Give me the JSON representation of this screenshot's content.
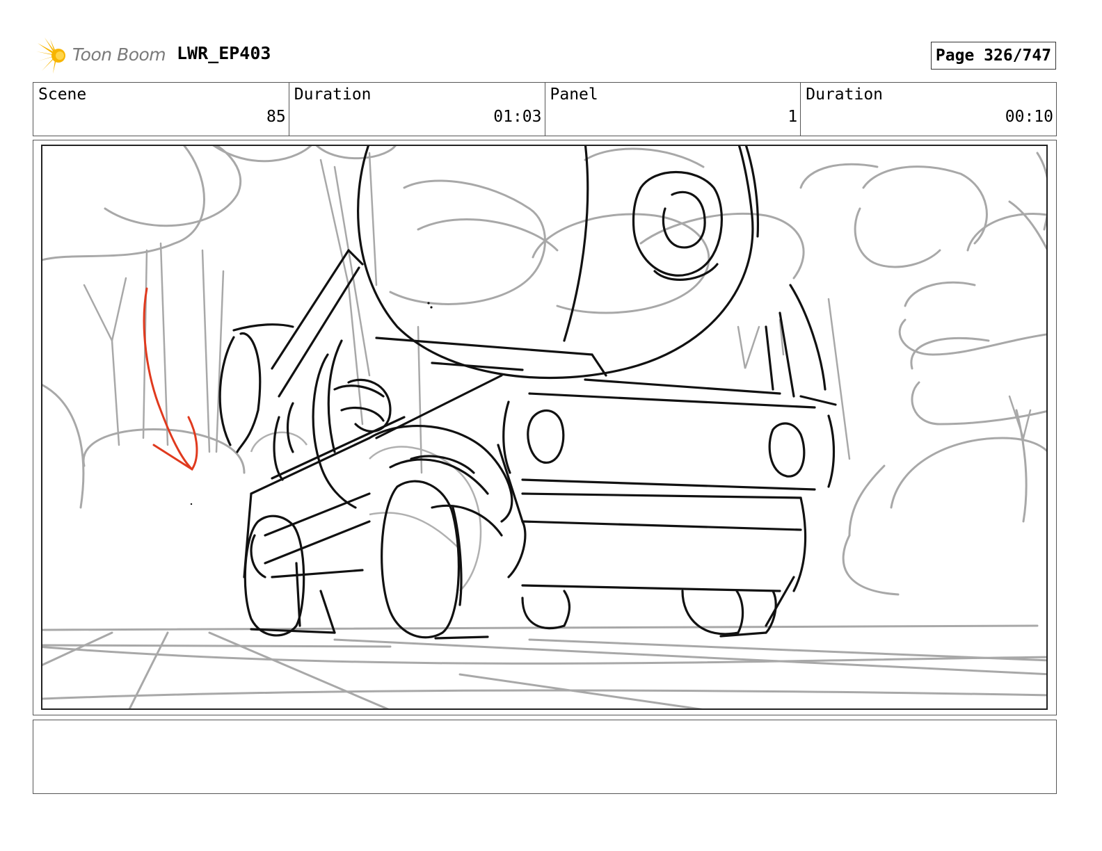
{
  "header": {
    "logo_text": "Toon Boom",
    "project_title": "LWR_EP403",
    "page_label": "Page 326/747"
  },
  "info": {
    "scene_label": "Scene",
    "scene_value": "85",
    "scene_duration_label": "Duration",
    "scene_duration_value": "01:03",
    "panel_label": "Panel",
    "panel_value": "1",
    "panel_duration_label": "Duration",
    "panel_duration_value": "00:10"
  },
  "colors": {
    "sketch_line": "#111111",
    "background_line": "#a8a8a8",
    "accent_red": "#e03a1e",
    "logo_yellow": "#f7b500"
  }
}
